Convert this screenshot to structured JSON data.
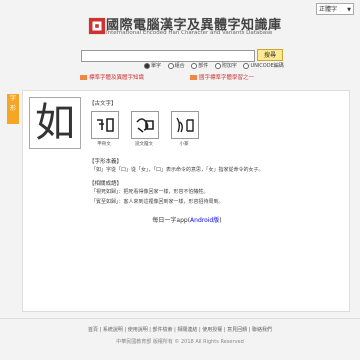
{
  "language_select": {
    "value": "正體字"
  },
  "header": {
    "title": "國際電腦漢字及異體字知識庫",
    "subtitle": "International Encoded Han Character and Variants Database"
  },
  "search": {
    "button_label": "搜尋",
    "options": [
      "單字",
      "組合",
      "部件",
      "附加字",
      "UNICODE編碼"
    ]
  },
  "promos": {
    "left": "標準字體及異體字知識",
    "right": "國字標準字體學習之一"
  },
  "side_tab": "字\n形",
  "entry": {
    "character": "如",
    "ancient_heading": "【古文字】",
    "glyph_labels": [
      "甲骨文",
      "說文籀文",
      "小篆"
    ],
    "meaning_heading": "【字形本義】",
    "meaning_text": "「如」字從「口」從「女」，「口」表示命令的意思，「女」指家從命令的女子。",
    "usage_heading": "【相關成語】",
    "usage_lines": [
      "「視死如歸」：把死看得像回家一樣，形容不怕犧牲。",
      "「賓至如歸」：客人來到這裡像回到家一樣，形容招待周到。"
    ],
    "app_text": "每日一字app",
    "app_link": "Android版"
  },
  "footer": {
    "links": "首頁 | 系統說明 | 使用說明 | 部件檢索 | 相關連結 | 使用授權 | 意見回饋 | 聯絡我們",
    "copyright": "中華民國教育部 版權所有 © 2018 All Rights Reserved"
  },
  "colors": {
    "accent": "#f5a623",
    "promo": "#cc3333",
    "button": "#fde98f"
  }
}
